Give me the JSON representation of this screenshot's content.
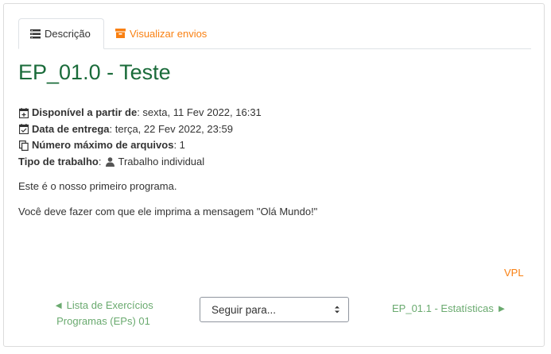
{
  "tabs": [
    {
      "label": "Descrição",
      "icon": "list-icon"
    },
    {
      "label": "Visualizar envios",
      "icon": "archive-icon",
      "color": "#f98012"
    }
  ],
  "activity": {
    "title": "EP_01.0 - Teste",
    "title_color": "#1a6b3a",
    "available_from_label": "Disponível a partir de",
    "available_from_value": ": sexta, 11 Fev 2022, 16:31",
    "due_date_label": "Data de entrega",
    "due_date_value": ": terça, 22 Fev 2022, 23:59",
    "max_files_label": "Número máximo de arquivos",
    "max_files_value": ": 1",
    "work_type_label": "Tipo de trabalho",
    "work_type_sep": ":",
    "work_type_value": "Trabalho individual"
  },
  "description": [
    "Este é o nosso primeiro programa.",
    "Você deve fazer com que ele imprima a mensagem \"Olá Mundo!\""
  ],
  "footer": {
    "vpl_link": "VPL",
    "prev_line1": "◄ Lista de Exercícios",
    "prev_line2": "Programas (EPs) 01",
    "jump_placeholder": "Seguir para...",
    "next_link": "EP_01.1 - Estatísticas ►"
  },
  "colors": {
    "accent": "#f98012",
    "nav_link": "#6aaa6f"
  }
}
